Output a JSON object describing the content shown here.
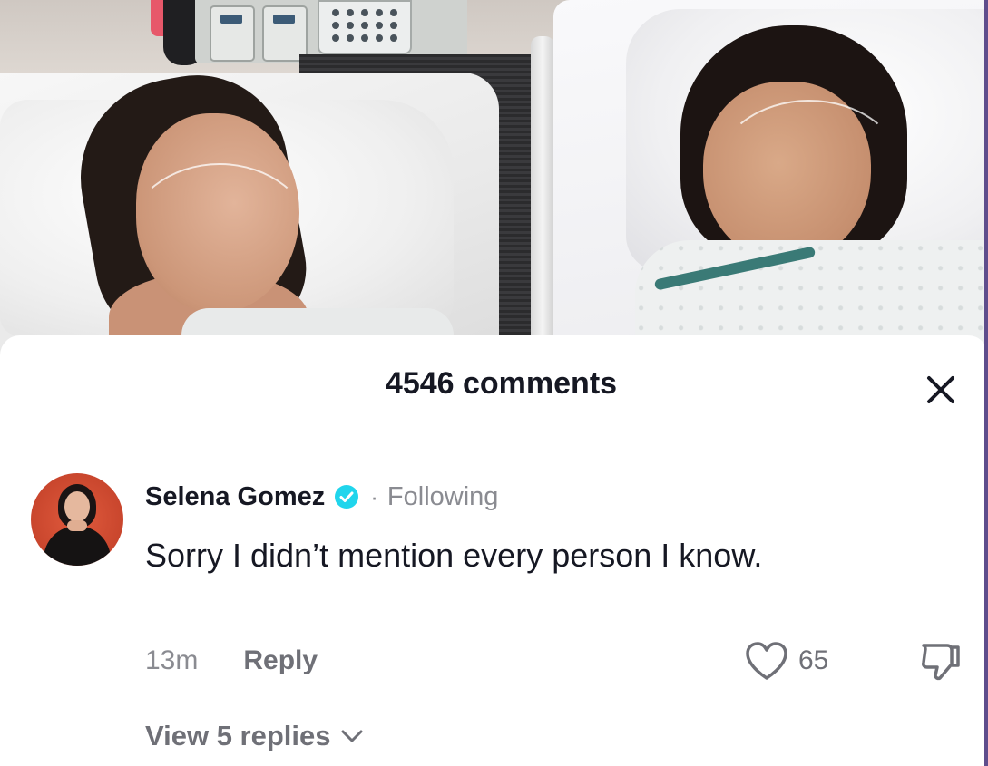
{
  "video": {
    "description_icon": "hospital-photo"
  },
  "comments_sheet": {
    "title": "4546 comments",
    "close_icon": "close-icon"
  },
  "comment": {
    "username": "Selena Gomez",
    "verified_icon": "verified-badge-icon",
    "separator": "·",
    "follow_status": "Following",
    "text": "Sorry I didn’t mention every person I know.",
    "time": "13m",
    "reply_label": "Reply",
    "like_icon": "heart-icon",
    "like_count": "65",
    "dislike_icon": "thumbs-down-icon",
    "view_replies_label": "View 5 replies",
    "view_replies_icon": "chevron-down-icon"
  },
  "colors": {
    "verified": "#20d5ec",
    "text_primary": "#161823",
    "text_secondary": "#8a8b91"
  }
}
